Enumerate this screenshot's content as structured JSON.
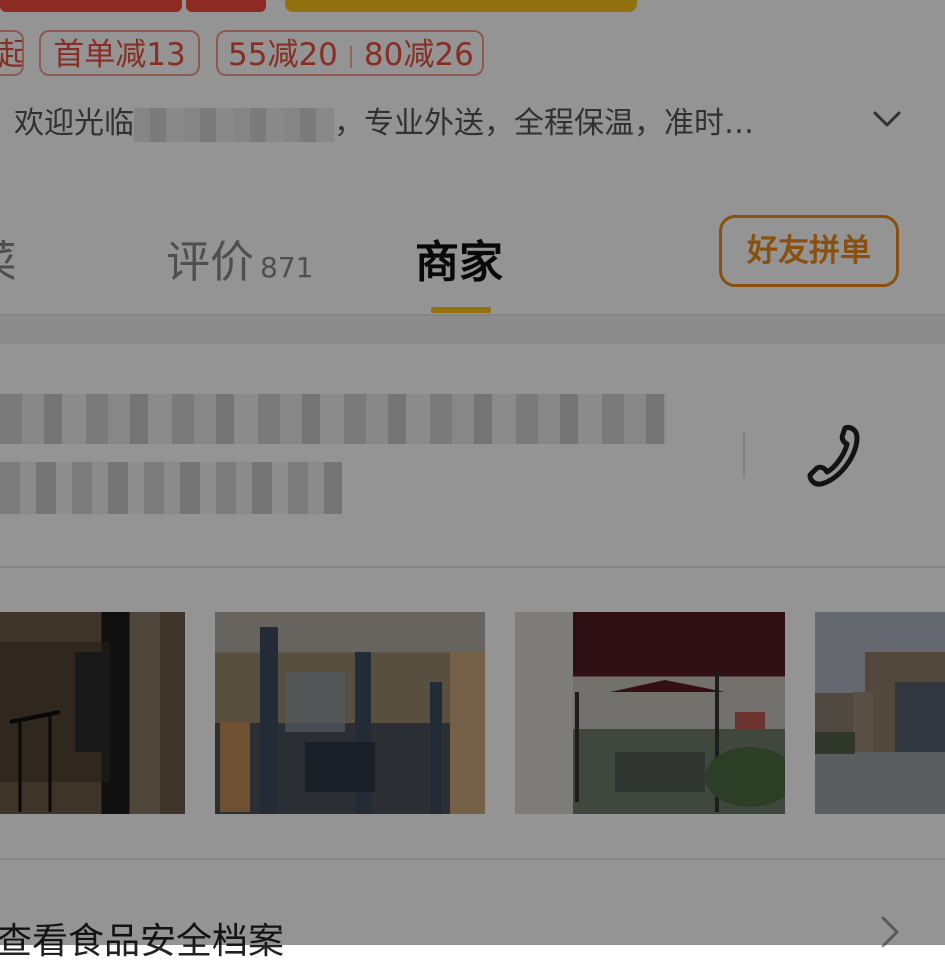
{
  "promo_tags": {
    "partial_tag": "起",
    "first_order": "首单减13",
    "discount_a": "55减20",
    "discount_b": "80减26"
  },
  "announcement": {
    "prefix": "欢迎光临",
    "suffix": "，专业外送，全程保温，准时…"
  },
  "tabs": {
    "partial_tab": "菜",
    "reviews_label": "评价",
    "reviews_count": "871",
    "merchant_label": "商家"
  },
  "friend_group_button": "好友拼单",
  "safety": {
    "label": "查看食品安全档案"
  },
  "colors": {
    "accent_yellow": "#f8c41a",
    "accent_orange": "#ee8b1a",
    "promo_red": "#e8503f"
  },
  "icons": [
    "chevron-down-icon",
    "phone-icon",
    "chevron-right-icon"
  ]
}
